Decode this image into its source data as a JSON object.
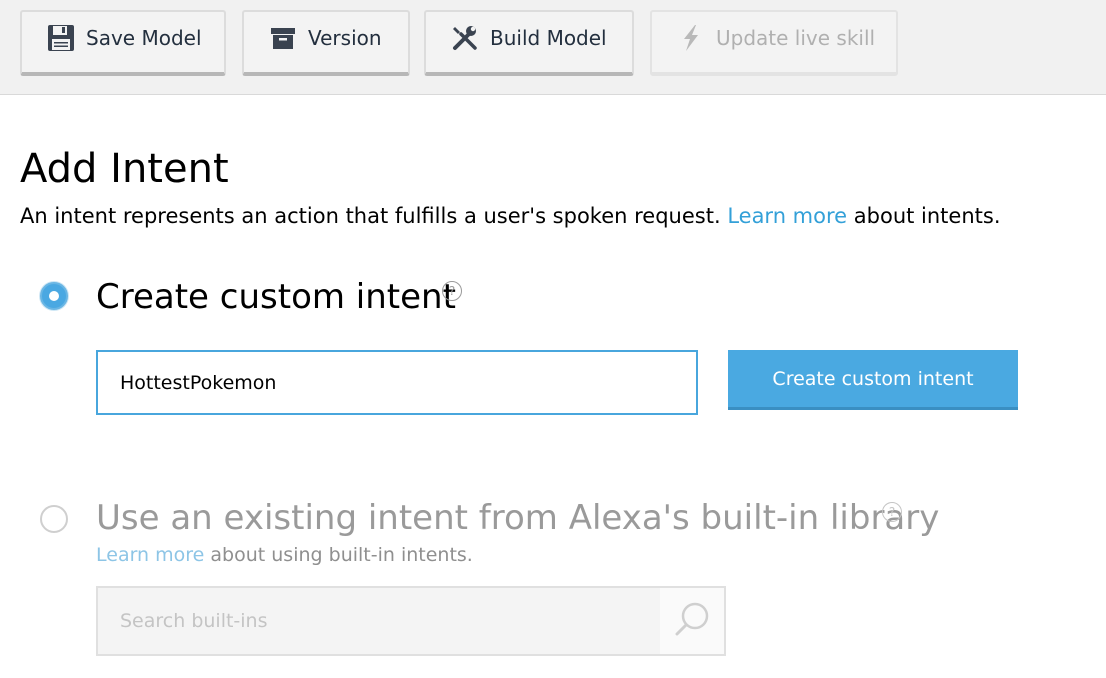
{
  "toolbar": {
    "save_label": "Save Model",
    "version_label": "Version",
    "build_label": "Build Model",
    "update_label": "Update live skill"
  },
  "page": {
    "title": "Add Intent",
    "subtitle_prefix": "An intent represents an action that fulfills a user's spoken request.",
    "subtitle_link": "Learn more",
    "subtitle_suffix": "about intents."
  },
  "custom_intent": {
    "label": "Create custom intent",
    "input_value": "HottestPokemon",
    "button_label": "Create custom intent",
    "help_glyph": "?",
    "selected": true
  },
  "builtin_intent": {
    "label": "Use an existing intent from Alexa's built-in library",
    "sub_link": "Learn more",
    "sub_text": "about using built-in intents.",
    "search_placeholder": "Search built-ins",
    "help_glyph": "?",
    "selected": false
  },
  "icons": {
    "save": "floppy-disk-icon",
    "version": "archive-box-icon",
    "build": "wrench-screwdriver-icon",
    "update": "lightning-bolt-icon",
    "search": "magnifier-icon"
  },
  "colors": {
    "accent": "#4aa9e1",
    "link": "#33a0d8",
    "toolbar_bg": "#f1f1f1",
    "disabled_text": "#b0b0b0"
  }
}
